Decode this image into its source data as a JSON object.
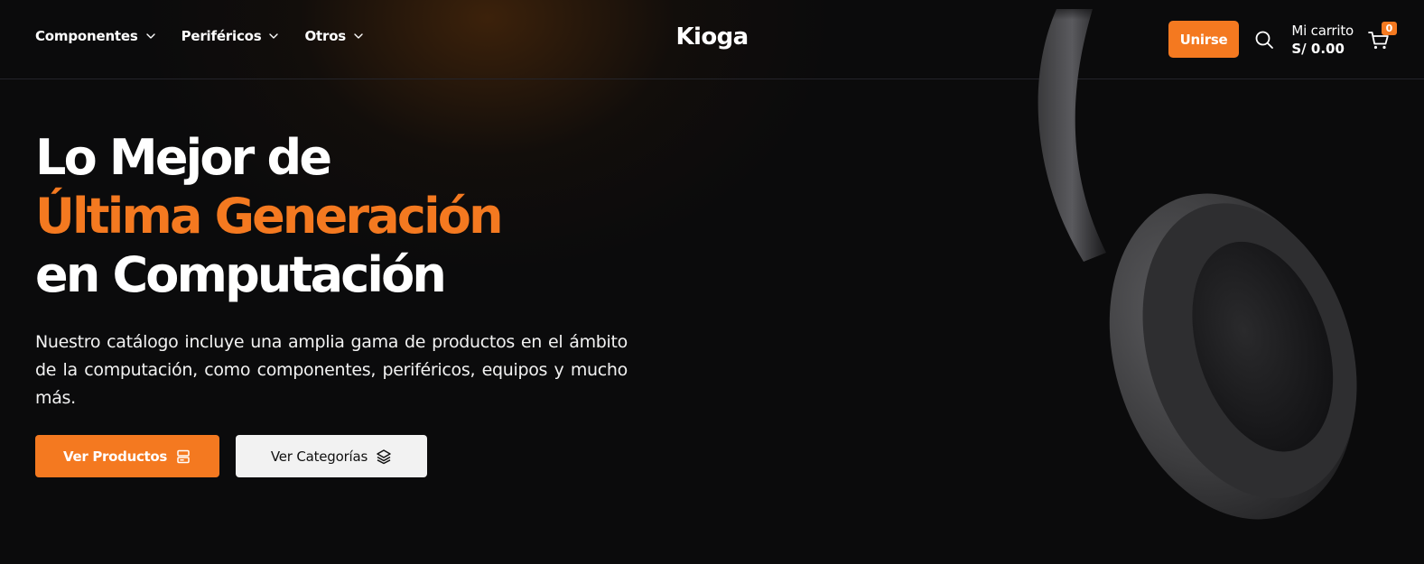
{
  "nav": {
    "items": [
      {
        "label": "Componentes",
        "icon": "chevron-down-icon"
      },
      {
        "label": "Periféricos",
        "icon": "chevron-down-icon"
      },
      {
        "label": "Otros",
        "icon": "chevron-down-icon"
      }
    ]
  },
  "brand": "Kioga",
  "header": {
    "join_label": "Unirse",
    "search_icon": "search-icon",
    "cart_label": "Mi carrito",
    "cart_total": "S/ 0.00",
    "cart_count": "0",
    "cart_icon": "cart-icon"
  },
  "hero": {
    "line1": "Lo Mejor de",
    "line2": "Última Generación",
    "line3": "en Computación",
    "description": "Nuestro catálogo incluye una amplia gama de productos en el ámbito de la computación, como componentes, periféricos, equipos y mucho más.",
    "primary_button": "Ver Productos",
    "primary_icon": "hdd-icon",
    "secondary_button": "Ver Categorías",
    "secondary_icon": "layers-icon",
    "image": "headphones-image"
  },
  "colors": {
    "accent": "#f47920",
    "background": "#0b0b0c",
    "text": "#ffffff",
    "secondary_button_bg": "#f2f2f2"
  }
}
